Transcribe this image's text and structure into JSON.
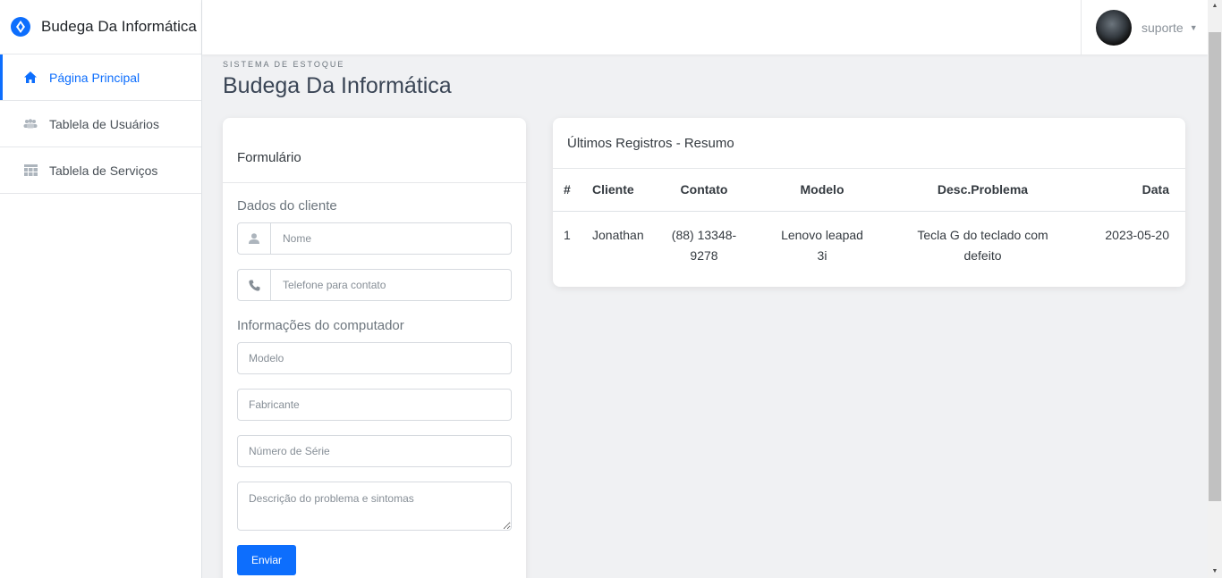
{
  "brand": {
    "name": "Budega Da Informática"
  },
  "sidebar": {
    "items": [
      {
        "label": "Página Principal",
        "icon": "home-icon",
        "active": true
      },
      {
        "label": "Tablela de Usuários",
        "icon": "users-icon",
        "active": false
      },
      {
        "label": "Tablela de Serviços",
        "icon": "table-icon",
        "active": false
      }
    ]
  },
  "topbar": {
    "user_name": "suporte"
  },
  "page": {
    "eyebrow": "SISTEMA DE ESTOQUE",
    "title": "Budega Da Informática"
  },
  "form": {
    "title": "Formulário",
    "client_section": "Dados do cliente",
    "name_placeholder": "Nome",
    "phone_placeholder": "Telefone para contato",
    "computer_section": "Informações do computador",
    "model_placeholder": "Modelo",
    "manufacturer_placeholder": "Fabricante",
    "serial_placeholder": "Número de Série",
    "description_placeholder": "Descrição do problema e sintomas",
    "submit_label": "Enviar"
  },
  "summary": {
    "title": "Últimos Registros - Resumo",
    "columns": [
      "#",
      "Cliente",
      "Contato",
      "Modelo",
      "Desc.Problema",
      "Data"
    ],
    "rows": [
      [
        "1",
        "Jonathan",
        "(88) 13348-9278",
        "Lenovo leapad 3i",
        "Tecla G do teclado com defeito",
        "2023-05-20"
      ]
    ]
  },
  "colors": {
    "accent": "#0d6efd",
    "background": "#f0f1f3"
  }
}
